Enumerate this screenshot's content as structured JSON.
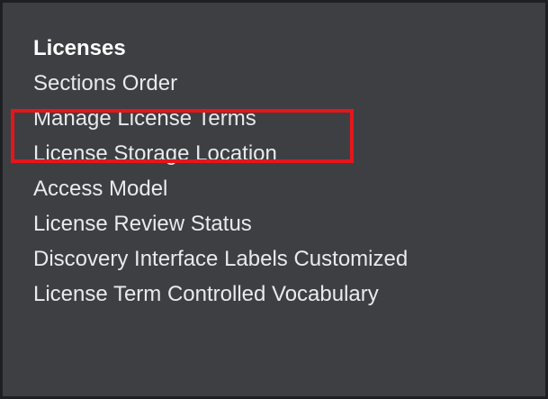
{
  "menu": {
    "heading": "Licenses",
    "items": [
      {
        "label": "Sections Order"
      },
      {
        "label": "Manage License Terms",
        "highlighted": true
      },
      {
        "label": "License Storage Location"
      },
      {
        "label": "Access Model"
      },
      {
        "label": "License Review Status"
      },
      {
        "label": "Discovery Interface Labels Customized"
      },
      {
        "label": "License Term Controlled Vocabulary"
      }
    ]
  },
  "colors": {
    "panel_background": "#3e3f43",
    "panel_border": "#1e1f22",
    "text": "#e9eaec",
    "highlight": "#e5161b"
  }
}
